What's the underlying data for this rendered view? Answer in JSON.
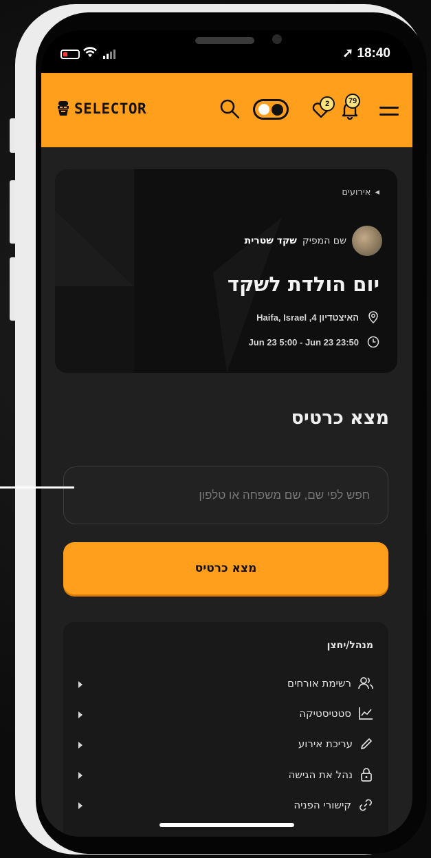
{
  "status_bar": {
    "time": "18:40"
  },
  "header": {
    "logo_text": "SELECTOR",
    "favorites_count": "2",
    "notifications_count": "79",
    "accent_color": "#ff9f1c"
  },
  "event": {
    "breadcrumb": "אירועים",
    "producer_prefix": "שם המפיק",
    "producer_name": "שקד שטרית",
    "title": "יום הולדת לשקד",
    "location": "האיצטדיון 4, Haifa, Israel",
    "time_range": "Jun 23 5:00 - Jun 23 23:50"
  },
  "find_tickets": {
    "title": "מצא כרטיס",
    "search_placeholder": "חפש לפי שם, שם משפחה או טלפון",
    "button_label": "מצא כרטיס"
  },
  "admin": {
    "title": "מנהל/יחצן",
    "items": [
      {
        "label": "רשימת אורחים",
        "icon": "users-icon"
      },
      {
        "label": "סטטיסטיקה",
        "icon": "chart-icon"
      },
      {
        "label": "עריכת אירוע",
        "icon": "pencil-icon"
      },
      {
        "label": "נהל את הגישה",
        "icon": "lock-icon"
      },
      {
        "label": "קישורי הפניה",
        "icon": "link-icon"
      }
    ]
  }
}
